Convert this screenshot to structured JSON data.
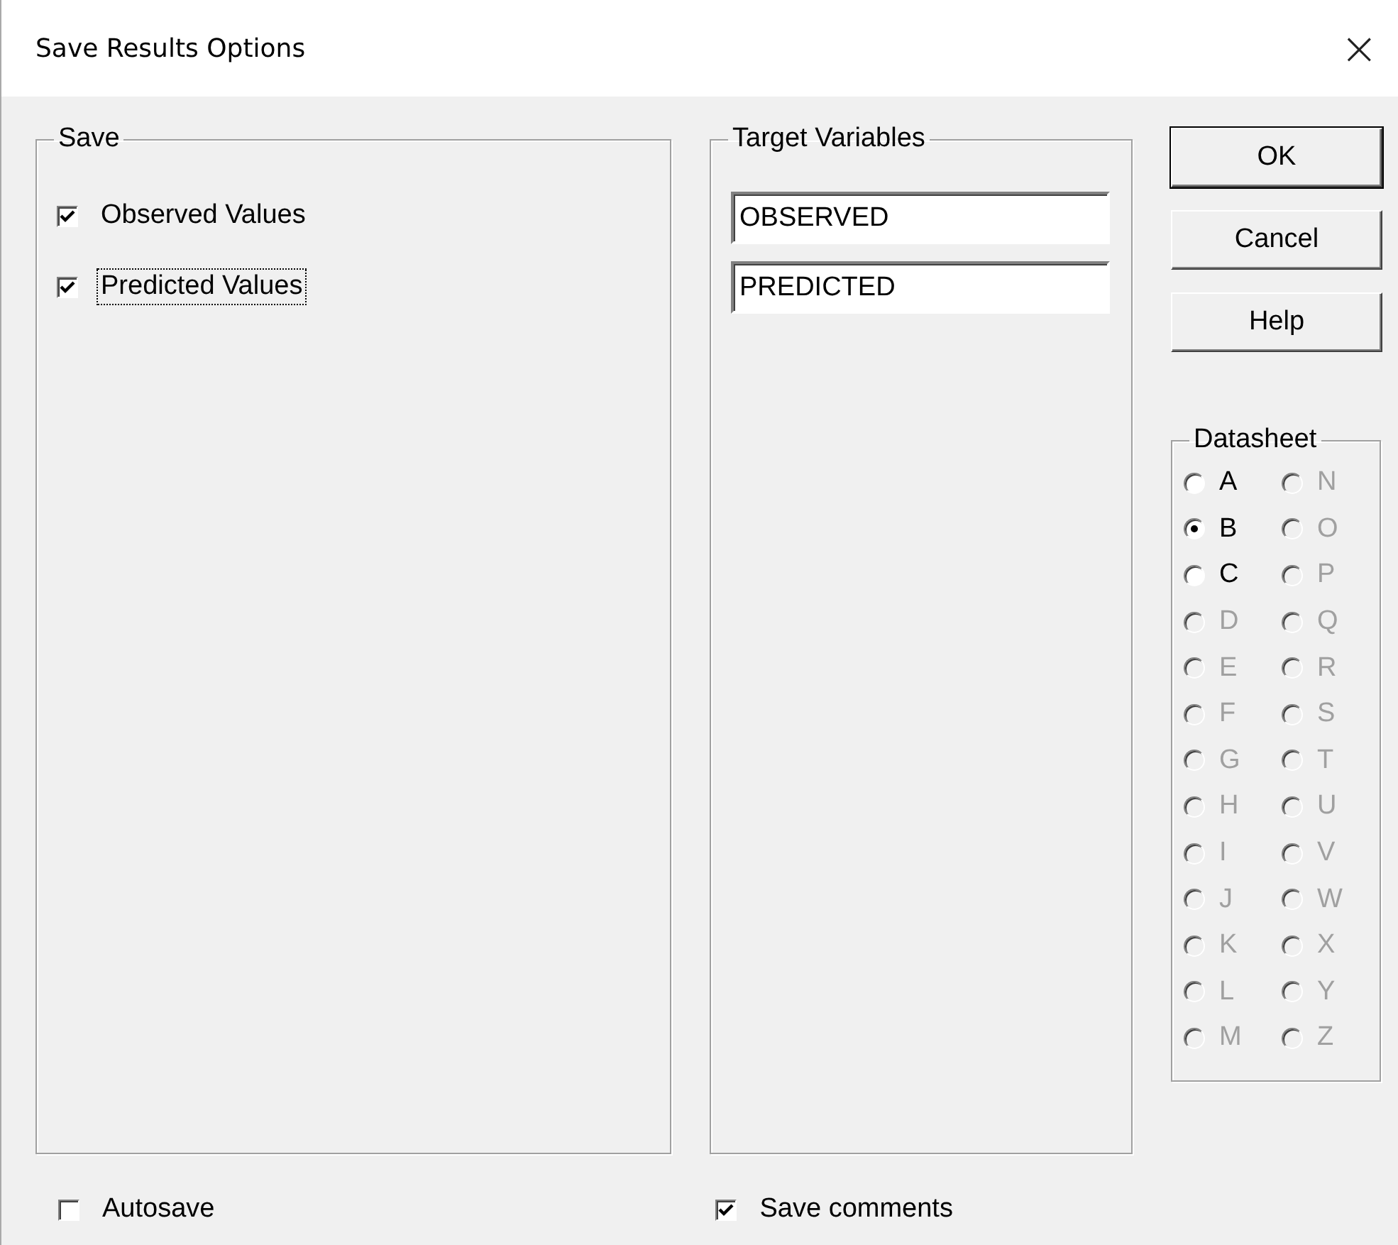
{
  "window": {
    "title": "Save Results Options",
    "close": "×"
  },
  "save": {
    "title": "Save",
    "options": [
      {
        "label": "Observed Values",
        "checked": true,
        "focused": false
      },
      {
        "label": "Predicted Values",
        "checked": true,
        "focused": true
      }
    ]
  },
  "target_variables": {
    "title": "Target Variables",
    "fields": [
      {
        "value": "OBSERVED"
      },
      {
        "value": "PREDICTED"
      }
    ]
  },
  "buttons": [
    {
      "label": "OK",
      "default": true
    },
    {
      "label": "Cancel",
      "default": false
    },
    {
      "label": "Help",
      "default": false
    }
  ],
  "datasheet": {
    "title": "Datasheet",
    "options": [
      {
        "label": "A",
        "selected": false,
        "disabled": false
      },
      {
        "label": "B",
        "selected": true,
        "disabled": false
      },
      {
        "label": "C",
        "selected": false,
        "disabled": false
      },
      {
        "label": "D",
        "selected": false,
        "disabled": true
      },
      {
        "label": "E",
        "selected": false,
        "disabled": true
      },
      {
        "label": "F",
        "selected": false,
        "disabled": true
      },
      {
        "label": "G",
        "selected": false,
        "disabled": true
      },
      {
        "label": "H",
        "selected": false,
        "disabled": true
      },
      {
        "label": "I",
        "selected": false,
        "disabled": true
      },
      {
        "label": "J",
        "selected": false,
        "disabled": true
      },
      {
        "label": "K",
        "selected": false,
        "disabled": true
      },
      {
        "label": "L",
        "selected": false,
        "disabled": true
      },
      {
        "label": "M",
        "selected": false,
        "disabled": true
      },
      {
        "label": "N",
        "selected": false,
        "disabled": true
      },
      {
        "label": "O",
        "selected": false,
        "disabled": true
      },
      {
        "label": "P",
        "selected": false,
        "disabled": true
      },
      {
        "label": "Q",
        "selected": false,
        "disabled": true
      },
      {
        "label": "R",
        "selected": false,
        "disabled": true
      },
      {
        "label": "S",
        "selected": false,
        "disabled": true
      },
      {
        "label": "T",
        "selected": false,
        "disabled": true
      },
      {
        "label": "U",
        "selected": false,
        "disabled": true
      },
      {
        "label": "V",
        "selected": false,
        "disabled": true
      },
      {
        "label": "W",
        "selected": false,
        "disabled": true
      },
      {
        "label": "X",
        "selected": false,
        "disabled": true
      },
      {
        "label": "Y",
        "selected": false,
        "disabled": true
      },
      {
        "label": "Z",
        "selected": false,
        "disabled": true
      }
    ]
  },
  "bottom_options": [
    {
      "label": "Autosave",
      "checked": false
    },
    {
      "label": "Save comments",
      "checked": true
    }
  ]
}
